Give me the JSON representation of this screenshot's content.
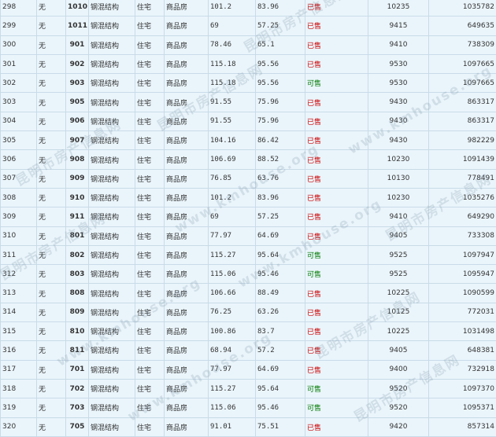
{
  "watermark_cn": "昆明市房产信息网",
  "watermark_url": "www.kmhouse.org",
  "rows": [
    {
      "idx": "298",
      "mark": "无",
      "room": "1010",
      "structure": "钢混结构",
      "use": "住宅",
      "type": "商品房",
      "area1": "101.2",
      "area2": "83.96",
      "status": "已售",
      "status_kind": "sold",
      "price": "10235",
      "total": "1035782"
    },
    {
      "idx": "299",
      "mark": "无",
      "room": "1011",
      "structure": "钢混结构",
      "use": "住宅",
      "type": "商品房",
      "area1": "69",
      "area2": "57.25",
      "status": "已售",
      "status_kind": "sold",
      "price": "9415",
      "total": "649635"
    },
    {
      "idx": "300",
      "mark": "无",
      "room": "901",
      "structure": "钢混结构",
      "use": "住宅",
      "type": "商品房",
      "area1": "78.46",
      "area2": "65.1",
      "status": "已售",
      "status_kind": "sold",
      "price": "9410",
      "total": "738309"
    },
    {
      "idx": "301",
      "mark": "无",
      "room": "902",
      "structure": "钢混结构",
      "use": "住宅",
      "type": "商品房",
      "area1": "115.18",
      "area2": "95.56",
      "status": "已售",
      "status_kind": "sold",
      "price": "9530",
      "total": "1097665"
    },
    {
      "idx": "302",
      "mark": "无",
      "room": "903",
      "structure": "钢混结构",
      "use": "住宅",
      "type": "商品房",
      "area1": "115.18",
      "area2": "95.56",
      "status": "可售",
      "status_kind": "avail",
      "price": "9530",
      "total": "1097665"
    },
    {
      "idx": "303",
      "mark": "无",
      "room": "905",
      "structure": "钢混结构",
      "use": "住宅",
      "type": "商品房",
      "area1": "91.55",
      "area2": "75.96",
      "status": "已售",
      "status_kind": "sold",
      "price": "9430",
      "total": "863317"
    },
    {
      "idx": "304",
      "mark": "无",
      "room": "906",
      "structure": "钢混结构",
      "use": "住宅",
      "type": "商品房",
      "area1": "91.55",
      "area2": "75.96",
      "status": "已售",
      "status_kind": "sold",
      "price": "9430",
      "total": "863317"
    },
    {
      "idx": "305",
      "mark": "无",
      "room": "907",
      "structure": "钢混结构",
      "use": "住宅",
      "type": "商品房",
      "area1": "104.16",
      "area2": "86.42",
      "status": "已售",
      "status_kind": "sold",
      "price": "9430",
      "total": "982229"
    },
    {
      "idx": "306",
      "mark": "无",
      "room": "908",
      "structure": "钢混结构",
      "use": "住宅",
      "type": "商品房",
      "area1": "106.69",
      "area2": "88.52",
      "status": "已售",
      "status_kind": "sold",
      "price": "10230",
      "total": "1091439"
    },
    {
      "idx": "307",
      "mark": "无",
      "room": "909",
      "structure": "钢混结构",
      "use": "住宅",
      "type": "商品房",
      "area1": "76.85",
      "area2": "63.76",
      "status": "已售",
      "status_kind": "sold",
      "price": "10130",
      "total": "778491"
    },
    {
      "idx": "308",
      "mark": "无",
      "room": "910",
      "structure": "钢混结构",
      "use": "住宅",
      "type": "商品房",
      "area1": "101.2",
      "area2": "83.96",
      "status": "已售",
      "status_kind": "sold",
      "price": "10230",
      "total": "1035276"
    },
    {
      "idx": "309",
      "mark": "无",
      "room": "911",
      "structure": "钢混结构",
      "use": "住宅",
      "type": "商品房",
      "area1": "69",
      "area2": "57.25",
      "status": "已售",
      "status_kind": "sold",
      "price": "9410",
      "total": "649290"
    },
    {
      "idx": "310",
      "mark": "无",
      "room": "801",
      "structure": "钢混结构",
      "use": "住宅",
      "type": "商品房",
      "area1": "77.97",
      "area2": "64.69",
      "status": "已售",
      "status_kind": "sold",
      "price": "9405",
      "total": "733308"
    },
    {
      "idx": "311",
      "mark": "无",
      "room": "802",
      "structure": "钢混结构",
      "use": "住宅",
      "type": "商品房",
      "area1": "115.27",
      "area2": "95.64",
      "status": "可售",
      "status_kind": "avail",
      "price": "9525",
      "total": "1097947"
    },
    {
      "idx": "312",
      "mark": "无",
      "room": "803",
      "structure": "钢混结构",
      "use": "住宅",
      "type": "商品房",
      "area1": "115.06",
      "area2": "95.46",
      "status": "可售",
      "status_kind": "avail",
      "price": "9525",
      "total": "1095947"
    },
    {
      "idx": "313",
      "mark": "无",
      "room": "808",
      "structure": "钢混结构",
      "use": "住宅",
      "type": "商品房",
      "area1": "106.66",
      "area2": "88.49",
      "status": "已售",
      "status_kind": "sold",
      "price": "10225",
      "total": "1090599"
    },
    {
      "idx": "314",
      "mark": "无",
      "room": "809",
      "structure": "钢混结构",
      "use": "住宅",
      "type": "商品房",
      "area1": "76.25",
      "area2": "63.26",
      "status": "已售",
      "status_kind": "sold",
      "price": "10125",
      "total": "772031"
    },
    {
      "idx": "315",
      "mark": "无",
      "room": "810",
      "structure": "钢混结构",
      "use": "住宅",
      "type": "商品房",
      "area1": "100.86",
      "area2": "83.7",
      "status": "已售",
      "status_kind": "sold",
      "price": "10225",
      "total": "1031498"
    },
    {
      "idx": "316",
      "mark": "无",
      "room": "811",
      "structure": "钢混结构",
      "use": "住宅",
      "type": "商品房",
      "area1": "68.94",
      "area2": "57.2",
      "status": "已售",
      "status_kind": "sold",
      "price": "9405",
      "total": "648381"
    },
    {
      "idx": "317",
      "mark": "无",
      "room": "701",
      "structure": "钢混结构",
      "use": "住宅",
      "type": "商品房",
      "area1": "77.97",
      "area2": "64.69",
      "status": "已售",
      "status_kind": "sold",
      "price": "9400",
      "total": "732918"
    },
    {
      "idx": "318",
      "mark": "无",
      "room": "702",
      "structure": "钢混结构",
      "use": "住宅",
      "type": "商品房",
      "area1": "115.27",
      "area2": "95.64",
      "status": "可售",
      "status_kind": "avail",
      "price": "9520",
      "total": "1097370"
    },
    {
      "idx": "319",
      "mark": "无",
      "room": "703",
      "structure": "钢混结构",
      "use": "住宅",
      "type": "商品房",
      "area1": "115.06",
      "area2": "95.46",
      "status": "可售",
      "status_kind": "avail",
      "price": "9520",
      "total": "1095371"
    },
    {
      "idx": "320",
      "mark": "无",
      "room": "705",
      "structure": "钢混结构",
      "use": "住宅",
      "type": "商品房",
      "area1": "91.01",
      "area2": "75.51",
      "status": "已售",
      "status_kind": "sold",
      "price": "9420",
      "total": "857314"
    }
  ]
}
